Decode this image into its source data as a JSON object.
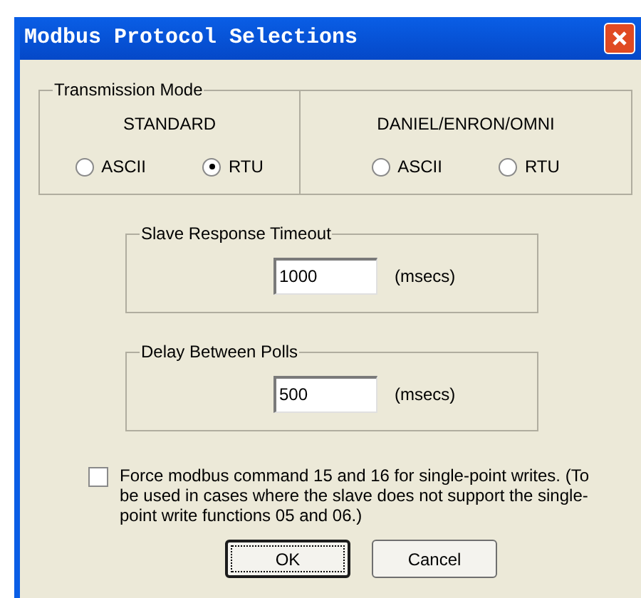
{
  "window": {
    "title": "Modbus Protocol Selections"
  },
  "transmission_mode": {
    "label": "Transmission Mode",
    "groups": [
      {
        "heading": "STANDARD",
        "options": [
          {
            "label": "ASCII",
            "selected": false
          },
          {
            "label": "RTU",
            "selected": true
          }
        ]
      },
      {
        "heading": "DANIEL/ENRON/OMNI",
        "options": [
          {
            "label": "ASCII",
            "selected": false
          },
          {
            "label": "RTU",
            "selected": false
          }
        ]
      }
    ]
  },
  "fields": [
    {
      "label": "Slave Response Timeout",
      "value": "1000",
      "unit": "(msecs)"
    },
    {
      "label": "Delay Between Polls",
      "value": "500",
      "unit": "(msecs)"
    }
  ],
  "force_option": {
    "label": "Force modbus command 15 and 16 for single-point writes. (To be used in cases where the slave does not support the single-point write functions 05 and 06.)",
    "checked": false
  },
  "buttons": [
    {
      "label": "OK",
      "kind": "default"
    },
    {
      "label": "Cancel",
      "kind": "normal"
    }
  ]
}
